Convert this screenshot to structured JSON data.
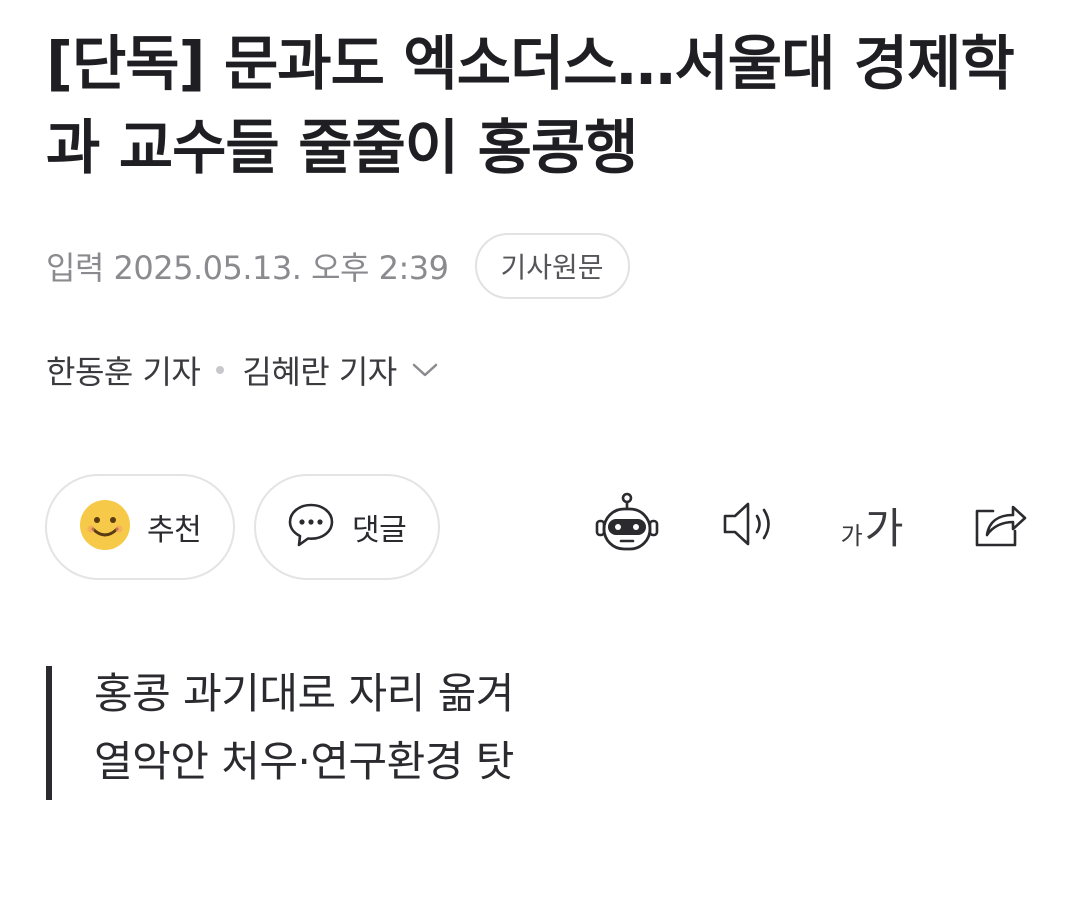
{
  "article": {
    "headline": "[단독] 문과도 엑소더스…서울대 경제학과 교수들 줄줄이 홍콩행",
    "date_label": "입력 2025.05.13. 오후 2:39",
    "original_button": "기사원문",
    "authors": [
      "한동훈 기자",
      "김혜란 기자"
    ],
    "summary_lines": [
      "홍콩 과기대로 자리 옮겨",
      "열악안 처우·연구환경 탓"
    ]
  },
  "actions": {
    "recommend_label": "추천",
    "comment_label": "댓글",
    "font_small": "가",
    "font_large": "가"
  },
  "icons": {
    "recommend": "smiley-face-icon",
    "comment": "speech-bubble-icon",
    "ai_summary": "robot-icon",
    "tts": "speaker-icon",
    "font_size": "font-size-icon",
    "share": "share-icon",
    "expand": "chevron-down-icon"
  },
  "colors": {
    "text_primary": "#1e1e23",
    "text_meta": "#8b8b8f",
    "border": "#e4e4e7",
    "smiley": "#f7c948"
  }
}
